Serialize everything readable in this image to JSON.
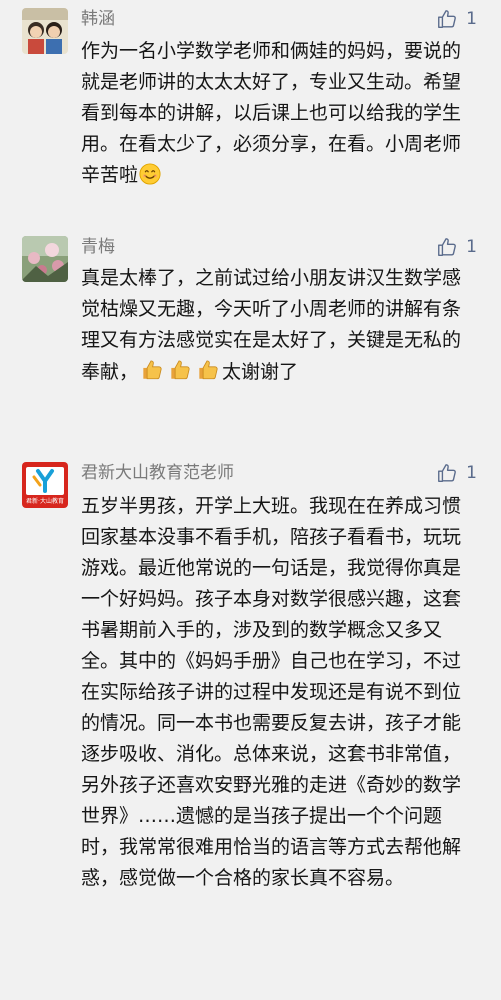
{
  "comments": [
    {
      "name": "韩涵",
      "likes": "1",
      "text": "作为一名小学数学老师和俩娃的妈妈，要说的就是老师讲的太太太好了，专业又生动。希望看到每本的讲解，以后课上也可以给我的学生用。在看太少了，必须分享，在看。小周老师辛苦啦",
      "emoji_after": "smile-emoji"
    },
    {
      "name": "青梅",
      "likes": "1",
      "text_before": "真是太棒了，之前试过给小朋友讲汉生数学感觉枯燥又无趣，今天听了小周老师的讲解有条理又有方法感觉实在是太好了，关键是无私的奉献，",
      "emoji_mid": [
        "thumbs-up-emoji",
        "thumbs-up-emoji",
        "thumbs-up-emoji"
      ],
      "text_after": "太谢谢了"
    },
    {
      "name": "君新大山教育范老师",
      "likes": "1",
      "avatar_text": "君新·大山教育",
      "text": "五岁半男孩，开学上大班。我现在在养成习惯回家基本没事不看手机，陪孩子看看书，玩玩游戏。最近他常说的一句话是，我觉得你真是一个好妈妈。孩子本身对数学很感兴趣，这套书暑期前入手的，涉及到的数学概念又多又全。其中的《妈妈手册》自己也在学习，不过在实际给孩子讲的过程中发现还是有说不到位的情况。同一本书也需要反复去讲，孩子才能逐步吸收、消化。总体来说，这套书非常值，另外孩子还喜欢安野光雅的走进《奇妙的数学世界》……遗憾的是当孩子提出一个个问题时，我常常很难用恰当的语言等方式去帮他解惑，感觉做一个合格的家长真不容易。"
    }
  ],
  "colors": {
    "background": "#f1f1f1",
    "name": "#7a7a7a",
    "like": "#5a6b8c",
    "text": "#161616"
  }
}
